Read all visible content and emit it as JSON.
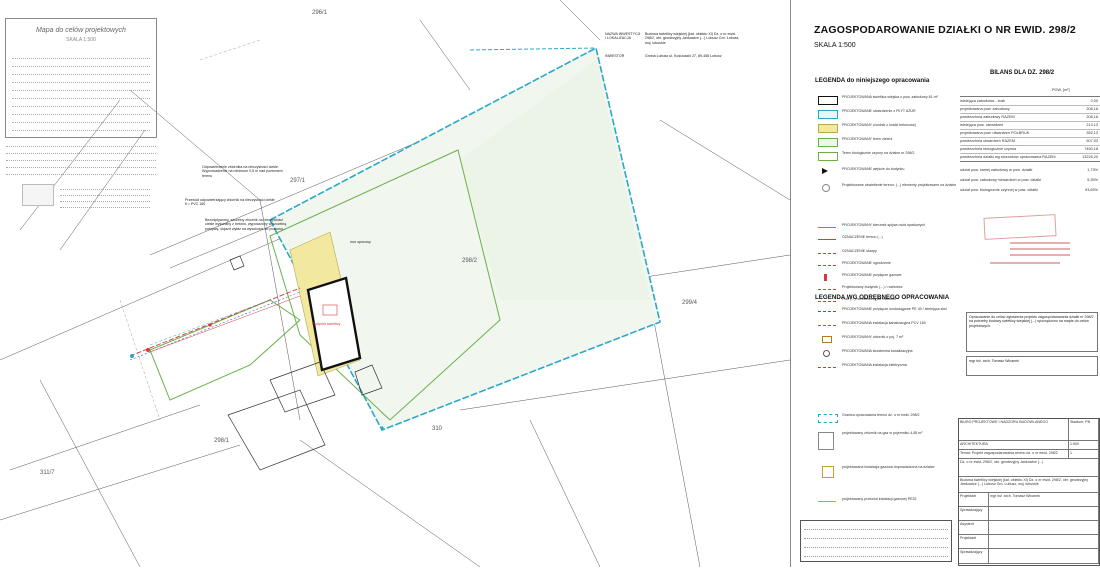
{
  "header": {
    "title": "ZAGOSPODAROWANIE DZIAŁKI O NR EWID. 298/2",
    "scale": "SKALA 1:500"
  },
  "map_stamp": {
    "title": "Mapa do celów projektowych",
    "scale": "SKALA 1:500"
  },
  "investor_block": {
    "label_object": "NAZWA INWESTYCJI / LOKALIZACJA",
    "object_text": "Budowa świetlicy wiejskiej (kat. obiektu XI) Dz. o nr ewid. 298/2, obr. geodezyjny Jankowice (...) Lubusz Gm. Lubusz, woj. lubuskie",
    "label_investor": "INWESTOR",
    "investor_text": "Gmina Lubusz ul. Kościuszki 27, 89-458 Lubusz"
  },
  "legend_title": "LEGENDA do niniejszego opracowania",
  "legend_items": [
    "PROJEKTOWANA świetlica wiejska o pow. zabudowy 81 m²",
    "PROJEKTOWANE utwardzenie z PŁYT AŻUR",
    "PROJEKTOWANY chodnik z kostki betonowej",
    "PROJEKTOWANY teren zieleni",
    "Teren biologicznie czynny na działce nr 298/2",
    "PROJEKTOWANE wejście do budynku",
    "Projektowane oświetlenie terenu: (...) elementy projektowane na działce",
    "PROJEKTOWANY kierunek spływu wód opadowych",
    "OZNACZENIE terenu (...)",
    "OZNACZENIE skarpy",
    "PROJEKTOWANE ogrodzenie",
    "PROJEKTOWANE przyłącze gazowe",
    "Projektowany budynek (...) / rozbiórka",
    "Pole (...) na elementy do rozbiórki"
  ],
  "legend2_title": "LEGENDA WG ODRĘBNEGO OPRACOWANIA",
  "legend2_items": [
    "PROJEKTOWANE przyłącze wodociągowe PE 40 / istniejąca sieć",
    "PROJEKTOWANA instalacja kanalizacyjna PCV 160",
    "PROJEKTOWANY zbiornik o poj. 7 m³",
    "PROJEKTOWANA studzienka kanalizacyjna",
    "PROJEKTOWANA instalacja elektryczna"
  ],
  "balance": {
    "title": "BILANS DLA DZ. 298/2",
    "unit": "POW. [m²]",
    "rows": [
      {
        "label": "istniejąca zabudowa - brak",
        "value": "0,00"
      },
      {
        "label": "projektowana pow. zabudowy",
        "value": "208,16"
      },
      {
        "label": "powierzchnia zabudowy RAZEM",
        "value": "208,16"
      },
      {
        "label": "istniejąca pow. utwardzeń",
        "value": "213,13"
      },
      {
        "label": "projektowana pow. utwardzeń POLBRUK",
        "value": "352,13"
      },
      {
        "label": "powierzchnia utwardzeń RAZEM",
        "value": "507,03"
      },
      {
        "label": "powierzchnia biologicznie czynna",
        "value": "7450,18"
      },
      {
        "label": "powierzchnia działki wg stosunków opracowania RAZEM",
        "value": "13226,20"
      }
    ],
    "ratios": [
      {
        "label": "udział pow. samej zabudowy w pow. działki",
        "value": "1,73%"
      },
      {
        "label": "udział pow. zabudowy+utwardzeń w pow. działki",
        "value": "5,35%"
      },
      {
        "label": "udział pow. biologicznie czynnej w pow. działki",
        "value": "93,65%"
      }
    ]
  },
  "lower_legend": [
    "Granica opracowania terenu dz. o nr ewid. 298/2",
    "projektowany zbiornik na gaz w pojemniku 4,85 m³",
    "projektowana instalacja gazowa doprowadzona na działce",
    "projektowany przewód instalacji gazowej PE32"
  ],
  "notes_block": "Opracowanie do celów zgłoszenia projektu zagospodarowania działki nr 298/2 na potrzeby budowy świetlicy wiejskiej (...) sporządzono na mapie do celów projektowych.",
  "titleblock": {
    "company": "BIURO PROJEKTOWE I NADZORU BUDOWLANEGO",
    "branch": "ARCHITEKTURA",
    "title_row": "Temat: Projekt zagospodarowania terenu dz. o nr ewid. 298/2",
    "stage": "Stadium: PB",
    "scale": "1:500",
    "sheet": "1",
    "address_row": "Dz. o nr ewid. 298/2, obr. geodezyjny Jankowice (...)",
    "designer": "mgr inż. arch. Tomasz Wicanek",
    "roles": [
      "Projektant",
      "Sprawdzający",
      "Asystent",
      "Projektant",
      "Sprawdzający"
    ]
  },
  "map_labels": {
    "parcel_main": "298/2",
    "parcel_a": "298/1",
    "parcel_b": "299/4",
    "parcel_c": "310",
    "parcel_d": "311/7",
    "parcel_e": "296/1",
    "parcel_f": "297/1",
    "building_note": "Budynek świetlicy",
    "note1": "Odpowietrzenie zbiornika na nieczystości ciekłe. Wyprowadzenie na minimum 0,5 m nad poziomem terenu",
    "note2": "Przewód odpowietrzający zbiornik na nieczystości ciekłe fi = PVC 160",
    "note3": "Bezodpływowy, szczelny zbiornik na nieczystości ciekłe wykonany z betonu, wyposażony w szczelną pokrywę, dojazd wyłaz na wysokości od poziomu...",
    "mur": "mur oporowy",
    "stairs": "stopnie"
  },
  "colors": {
    "boundary": "#2aa8c9",
    "green": "#6ab04c",
    "red": "#d63a3a",
    "pale_green": "#eef6e8",
    "yellow": "#f2e8a0"
  }
}
